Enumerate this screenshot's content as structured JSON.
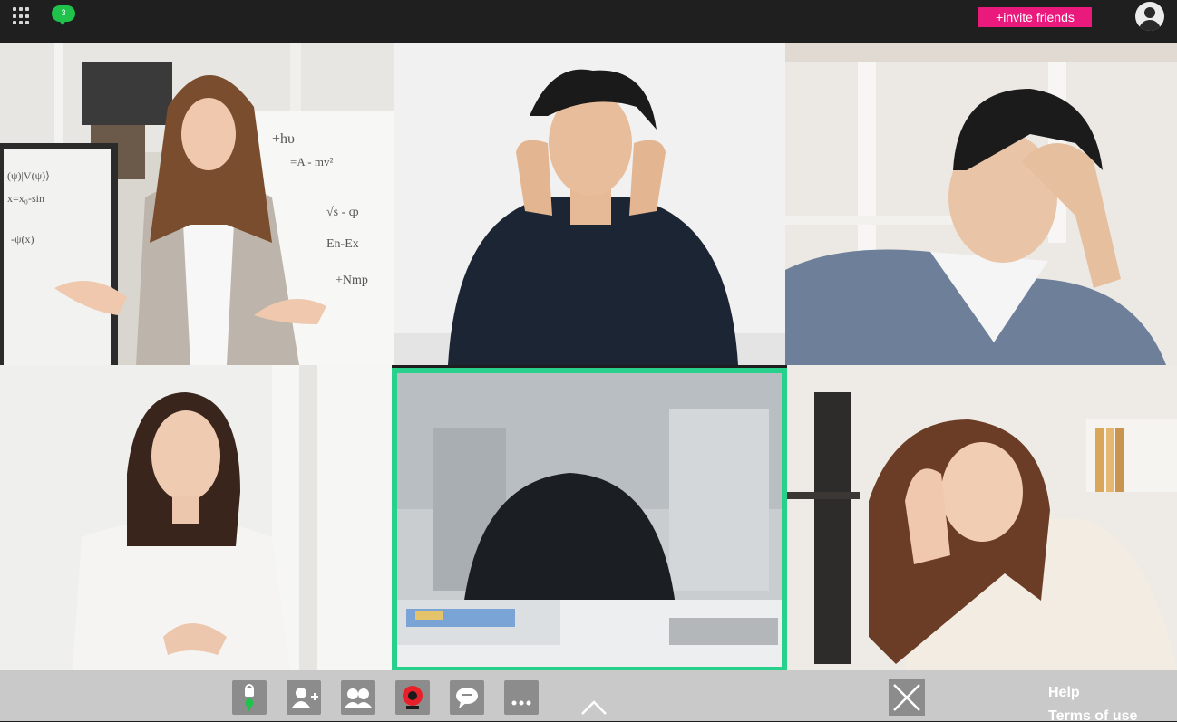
{
  "header": {
    "apps_icon": "grid-dots",
    "chat_count": "3",
    "invite_label": "+invite friends",
    "user_icon": "user-avatar"
  },
  "participants": [
    {
      "name": "",
      "role": "presenter"
    },
    {
      "name": "",
      "role": "attendee"
    },
    {
      "name": "",
      "role": "attendee"
    },
    {
      "name": "",
      "role": "attendee"
    },
    {
      "name": "",
      "role": "empty-seat",
      "highlighted": true
    },
    {
      "name": "",
      "role": "attendee"
    }
  ],
  "toolbar": {
    "buttons": [
      {
        "icon": "mic-lock-icon",
        "label": ""
      },
      {
        "icon": "add-user-icon",
        "label": ""
      },
      {
        "icon": "participants-icon",
        "label": ""
      },
      {
        "icon": "camera-icon",
        "label": ""
      },
      {
        "icon": "chat-icon",
        "label": ""
      },
      {
        "icon": "more-icon",
        "label": "..."
      }
    ],
    "help": "Help",
    "terms": "Terms of use"
  },
  "colors": {
    "accent": "#28d18b",
    "invite": "#ea1a7d",
    "camera": "#e8202a",
    "mic": "#1fc24a"
  }
}
